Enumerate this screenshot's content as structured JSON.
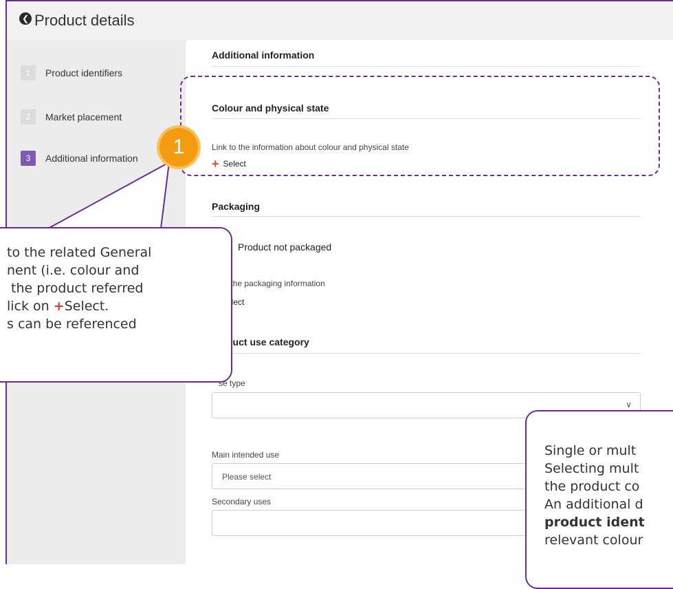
{
  "header": {
    "title": "Product details"
  },
  "sidebar": {
    "steps": [
      {
        "num": "1",
        "label": "Product identifiers"
      },
      {
        "num": "2",
        "label": "Market placement"
      },
      {
        "num": "3",
        "label": "Additional information"
      }
    ]
  },
  "main": {
    "section_additional": "Additional information",
    "colour": {
      "title": "Colour and physical state",
      "link_text": "Link to the information about colour and physical state",
      "select_label": "Select"
    },
    "packaging": {
      "title": "Packaging",
      "not_packaged": "Product not packaged",
      "link_text": "to the packaging information",
      "select_label": "Select"
    },
    "use_category": {
      "title": "duct use category",
      "use_type_label": "se type",
      "main_use_label": "Main intended use",
      "main_use_placeholder": "Please select",
      "secondary_label": "Secondary uses"
    }
  },
  "annotations": {
    "badge": "1",
    "callout1_lines": [
      "to the related General",
      "nent (i.e. colour and",
      " the product referred",
      "lick on ",
      "Select.",
      "s can be referenced"
    ],
    "callout1_plus": "+",
    "callout2_lines": [
      "Single or mult",
      "Selecting mult",
      "the product co",
      "An additional d",
      "product ident",
      "relevant colour"
    ]
  },
  "colors": {
    "accent": "#6b2c91",
    "badge": "#f39c12",
    "plus": "#e0542a"
  }
}
